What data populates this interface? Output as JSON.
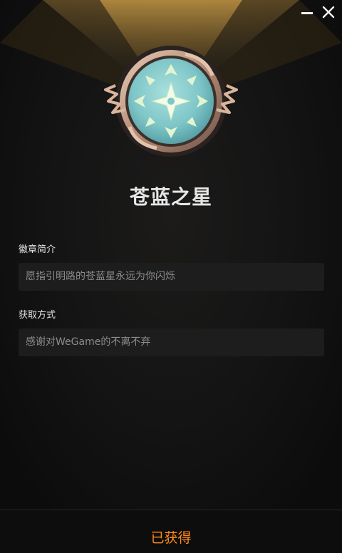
{
  "window": {
    "minimize_icon": "minimize-icon",
    "close_icon": "close-icon"
  },
  "badge": {
    "name": "苍蓝之星",
    "icon": "star-badge-icon",
    "colors": {
      "gem": "#7fc6c8",
      "frame": "#b48a74",
      "star": "#e9f7d8",
      "accent": "#ff8a1c"
    }
  },
  "description": {
    "label": "徽章简介",
    "text": "愿指引明路的苍蓝星永远为你闪烁"
  },
  "acquisition": {
    "label": "获取方式",
    "text": "感谢对WeGame的不离不弃"
  },
  "footer": {
    "status_label": "已获得"
  }
}
